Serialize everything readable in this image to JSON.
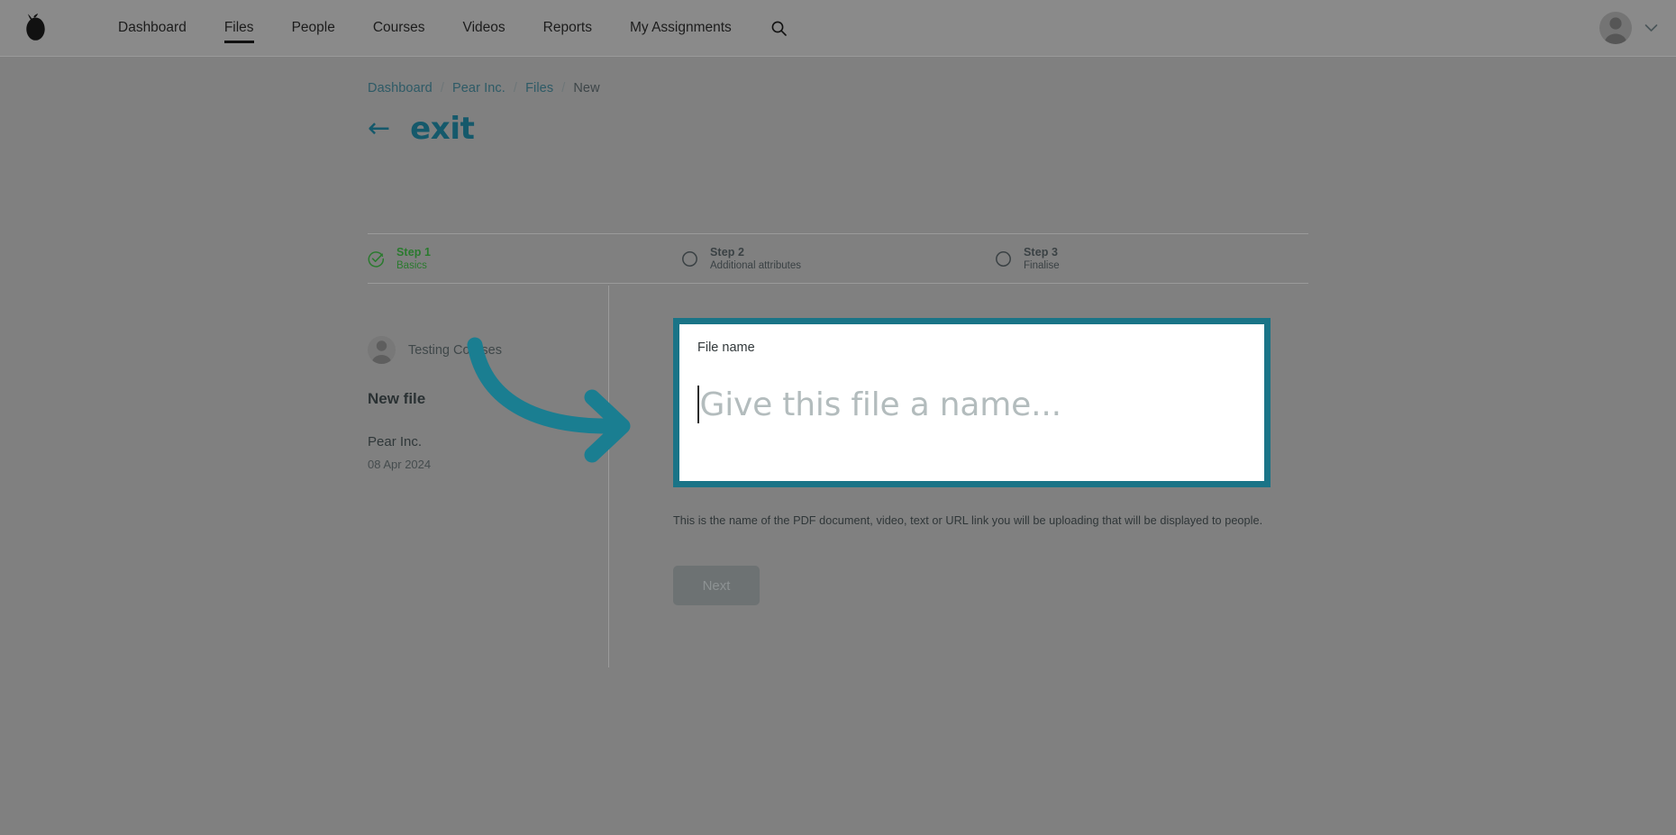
{
  "nav": {
    "logo_icon": "pear-logo-icon",
    "links": [
      {
        "label": "Dashboard",
        "active": false
      },
      {
        "label": "Files",
        "active": true
      },
      {
        "label": "People",
        "active": false
      },
      {
        "label": "Courses",
        "active": false
      },
      {
        "label": "Videos",
        "active": false
      },
      {
        "label": "Reports",
        "active": false
      },
      {
        "label": "My Assignments",
        "active": false
      }
    ],
    "search_icon": "search-icon",
    "avatar_icon": "user-avatar-icon",
    "chevron_icon": "chevron-down-icon"
  },
  "breadcrumb": {
    "items": [
      "Dashboard",
      "Pear Inc.",
      "Files",
      "New"
    ],
    "separator": "/"
  },
  "exit": {
    "arrow": "←",
    "label": "exit"
  },
  "stepper": {
    "steps": [
      {
        "title": "Step 1",
        "sub": "Basics",
        "state": "done",
        "icon": "check-circle-icon"
      },
      {
        "title": "Step 2",
        "sub": "Additional attributes",
        "state": "todo",
        "icon": "empty-circle-icon"
      },
      {
        "title": "Step 3",
        "sub": "Finalise",
        "state": "todo",
        "icon": "empty-circle-icon"
      }
    ]
  },
  "left_panel": {
    "user_name": "Testing Courses",
    "title": "New file",
    "organisation": "Pear Inc.",
    "date": "08 Apr 2024"
  },
  "form": {
    "field_label": "File name",
    "placeholder": "Give this file a name...",
    "value": "",
    "help_text": "This is the name of the PDF document, video, text or URL link you will be uploading that will be displayed to people.",
    "next_label": "Next"
  },
  "colors": {
    "accent_teal": "#1a7487",
    "exit_teal": "#15596b",
    "step_done_green": "#2a7a2e",
    "overlay_grey": "#808080",
    "nav_grey": "#8a8a8a"
  },
  "annotation": {
    "arrow_icon": "curved-arrow-annotation-icon"
  }
}
